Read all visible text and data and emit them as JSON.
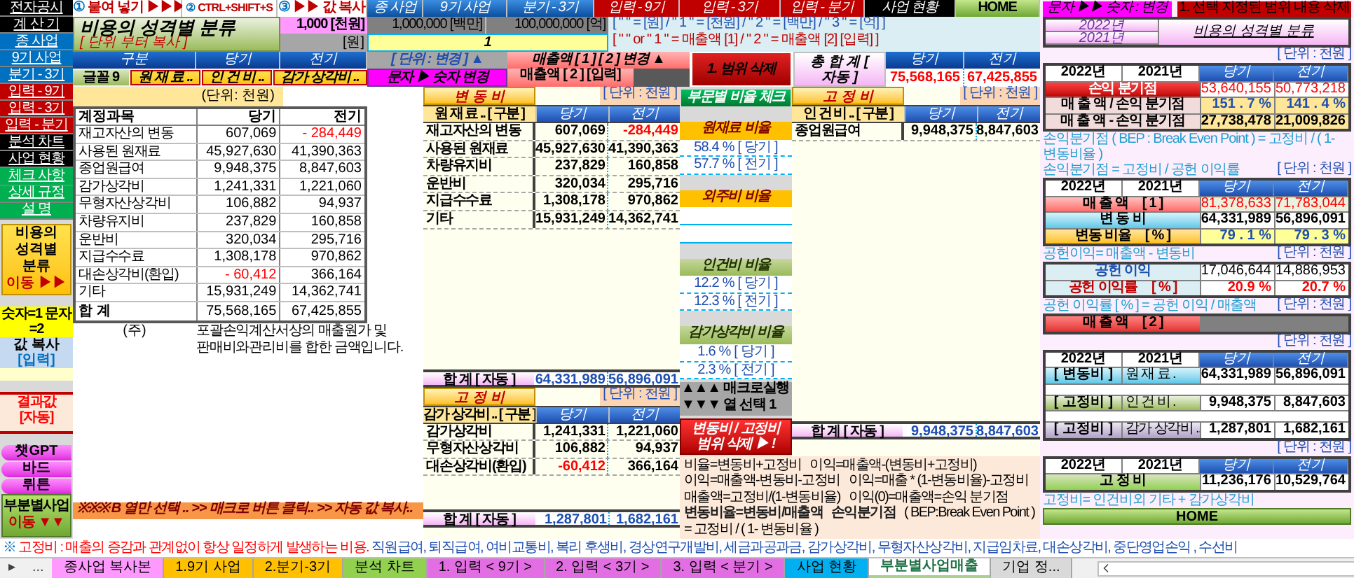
{
  "nav": [
    {
      "label": "전자공시",
      "kind": "dark"
    },
    {
      "label": "계 산 기",
      "kind": "dark"
    },
    {
      "label": "종 사업",
      "kind": "blue"
    },
    {
      "label": "9기 사업",
      "kind": "blue"
    },
    {
      "label": "분기 - 3기",
      "kind": "blue"
    },
    {
      "label": "입력 - 9기",
      "kind": "red"
    },
    {
      "label": "입력 - 3기",
      "kind": "red"
    },
    {
      "label": "입력 - 분기",
      "kind": "red"
    },
    {
      "label": "분석 차트",
      "kind": "dark"
    },
    {
      "label": "사업 현황",
      "kind": "dark"
    },
    {
      "label": "체크 사항",
      "kind": "green"
    },
    {
      "label": "상세 규정",
      "kind": "green"
    },
    {
      "label": "설 명",
      "kind": "green"
    }
  ],
  "nav_jump": {
    "lines": [
      "비용의",
      "성격별",
      "분류"
    ],
    "action": "이동 ▶▶"
  },
  "nav_mode": "숫자=1 문자=2",
  "nav_copy": {
    "label": "값 복사",
    "tag": "[입력]"
  },
  "nav_result": "결과값 [자동]",
  "nav_ai": [
    "챗GPT",
    "바드",
    "뤼튼"
  ],
  "nav_bottom": {
    "label": "부분별사업",
    "action": "이동 ▼▼"
  },
  "toolbar": [
    {
      "step": "①",
      "label": "붙여 넣기 ▶▶▶",
      "kind": "step"
    },
    {
      "step": "②",
      "label": "CTRL+SHIFT+S",
      "kind": "step"
    },
    {
      "step": "③",
      "label": "▶▶ 값 복사",
      "kind": "step"
    },
    {
      "label": "종 사업",
      "kind": "blue"
    },
    {
      "label": "9기 사업",
      "kind": "blue"
    },
    {
      "label": "분기 - 3기",
      "kind": "blue"
    },
    {
      "label": "입력 - 9기",
      "kind": "red"
    },
    {
      "label": "입력 - 3기",
      "kind": "red"
    },
    {
      "label": "입력 - 분기",
      "kind": "red"
    },
    {
      "label": "사업 현황",
      "kind": "dark"
    },
    {
      "label": "HOME",
      "kind": "green"
    }
  ],
  "title": {
    "text": "비용의 성격별 분류",
    "hint": "[ 단위 부터 복사 ]"
  },
  "units": {
    "thousand": "1,000 [천원]",
    "won": "[원]",
    "million": "1,000,000 [백만]",
    "hundred_million": "100,000,000 [억]",
    "selected_unit": "1",
    "legend_units": "[ \" \" = [원]  / \" 1 \" = [천원]  / \" 2 \" = [백만]  / \" 3 \" = [억] ]",
    "legend_sales": "[ \" \" or \" 1 \" = 매출액 [1]  / \" 2 \" = 매출액 [2] [입력] ]"
  },
  "header": {
    "col_1": "구분",
    "current": "당기",
    "prior": "전기",
    "unit_change": "[ 단위 : 변경 ] ▲",
    "sales_change": "매출액 [ 1 ] [ 2 ] 변경 ▲",
    "delete_range": "1. 범위 삭제",
    "text_to_number": "문자 ▶ 숫자 변경",
    "sales2_input": "매출액 [ 2 ] [입력]"
  },
  "grand_total": {
    "label": "총 합 계 [ 자동 ]",
    "current_header": "당기",
    "prior_header": "전기",
    "current": "75,568,165",
    "prior": "67,425,855"
  },
  "filters": [
    {
      "label": "글꼴 9",
      "kind": "font"
    },
    {
      "label": "원 재 료 ..",
      "kind": "category"
    },
    {
      "label": "인 건 비 ..",
      "kind": "category"
    },
    {
      "label": "감가 상각비 ..",
      "kind": "category"
    }
  ],
  "accounts": {
    "unit": "(단위: 천원)",
    "columns": [
      "계정과목",
      "당기",
      "전기"
    ],
    "rows": [
      {
        "name": "재고자산의 변동",
        "current": "607,069",
        "prior": "- 284,449",
        "current_negative": false,
        "prior_negative": true
      },
      {
        "name": "사용된 원재료",
        "current": "45,927,630",
        "prior": "41,390,363",
        "current_negative": false,
        "prior_negative": false
      },
      {
        "name": "종업원급여",
        "current": "9,948,375",
        "prior": "8,847,603",
        "current_negative": false,
        "prior_negative": false
      },
      {
        "name": "감가상각비",
        "current": "1,241,331",
        "prior": "1,221,060",
        "current_negative": false,
        "prior_negative": false
      },
      {
        "name": "무형자산상각비",
        "current": "106,882",
        "prior": "94,937",
        "current_negative": false,
        "prior_negative": false
      },
      {
        "name": "차량유지비",
        "current": "237,829",
        "prior": "160,858",
        "current_negative": false,
        "prior_negative": false
      },
      {
        "name": "운반비",
        "current": "320,034",
        "prior": "295,716",
        "current_negative": false,
        "prior_negative": false
      },
      {
        "name": "지급수수료",
        "current": "1,308,178",
        "prior": "970,862",
        "current_negative": false,
        "prior_negative": false
      },
      {
        "name": "대손상각비(환입)",
        "current": "- 60,412",
        "prior": "366,164",
        "current_negative": true,
        "prior_negative": false
      },
      {
        "name": "기타",
        "current": "15,931,249",
        "prior": "14,362,741",
        "current_negative": false,
        "prior_negative": false
      }
    ],
    "total": {
      "label": "합 계",
      "current": "75,568,165",
      "prior": "67,425,855"
    },
    "note_mark": "(주)",
    "note": "포괄손익계산서상의 매출원가 및 판매비와관리비를 합한 금액입니다."
  },
  "macro_hint": "※※※  B 열만 선택 ..  >>  매크로 버튼 클릭..  >>  자동 값 복사..",
  "variable_costs": {
    "title": "변 동 비",
    "unit": "[ 단위 : 천원 ]",
    "columns": [
      "원 재 료 .. [ 구분 ]",
      "당기",
      "전기"
    ],
    "rows": [
      {
        "name": "재고자산의 변동",
        "current": "607,069",
        "prior": "-284,449",
        "current_negative": false,
        "prior_negative": true
      },
      {
        "name": "사용된 원재료",
        "current": "45,927,630",
        "prior": "41,390,363",
        "current_negative": false,
        "prior_negative": false
      },
      {
        "name": "차량유지비",
        "current": "237,829",
        "prior": "160,858",
        "current_negative": false,
        "prior_negative": false
      },
      {
        "name": "운반비",
        "current": "320,034",
        "prior": "295,716",
        "current_negative": false,
        "prior_negative": false
      },
      {
        "name": "지급수수료",
        "current": "1,308,178",
        "prior": "970,862",
        "current_negative": false,
        "prior_negative": false
      },
      {
        "name": "기타",
        "current": "15,931,249",
        "prior": "14,362,741",
        "current_negative": false,
        "prior_negative": false
      }
    ],
    "total": {
      "label": "합 계 [ 자동 ]",
      "current": "64,331,989",
      "prior": "56,896,091"
    }
  },
  "depreciation": {
    "title": "고 정 비",
    "unit": "[ 단위 : 천원 ]",
    "columns": [
      "감가 상각비 .. [ 구분 ]",
      "당기",
      "전기"
    ],
    "rows": [
      {
        "name": "감가상각비",
        "current": "1,241,331",
        "prior": "1,221,060",
        "current_negative": false,
        "prior_negative": false
      },
      {
        "name": "무형자산상각비",
        "current": "106,882",
        "prior": "94,937",
        "current_negative": false,
        "prior_negative": false
      },
      {
        "name": "대손상각비(환입)",
        "current": "-60,412",
        "prior": "366,164",
        "current_negative": true,
        "prior_negative": false
      }
    ],
    "total": {
      "label": "합 계 [ 자동 ]",
      "current": "1,287,801",
      "prior": "1,682,161"
    }
  },
  "ratios": {
    "check_button": "부문별 비율 체크",
    "groups": [
      {
        "title": "원재료 비율",
        "kind": "gold",
        "current": "58.4 % [ 당기 ]",
        "prior": "57.7 % [ 전기 ]"
      },
      {
        "title": "외주비 비율",
        "kind": "gold"
      },
      {
        "title": "인건비 비율",
        "kind": "olive",
        "current": "12.2 % [ 당기 ]",
        "prior": "12.3 % [ 전기 ]"
      },
      {
        "title": "감가상각비 비율",
        "kind": "olive",
        "current": "1.6 % [ 당기 ]",
        "prior": "2.3 % [ 전기 ]"
      }
    ],
    "macro_run": "▲▲▲ 매크로실행",
    "column_select": "▼▼▼ 열 선택 1",
    "clear_button": "변동비 / 고정비 범위 삭제 ▶ !"
  },
  "labor": {
    "title": "고 정 비",
    "unit": "[ 단위 : 천원 ]",
    "columns": [
      "인 건 비 .. [ 구분 ]",
      "당기",
      "전기"
    ],
    "rows": [
      {
        "name": "종업원급여",
        "current": "9,948,375",
        "prior": "8,847,603",
        "current_negative": false,
        "prior_negative": false
      }
    ],
    "total": {
      "label": "합 계 [ 자동 ]",
      "current": "9,948,375",
      "prior": "8,847,603"
    }
  },
  "formulas": [
    {
      "text": "비율=변동비+고정비",
      "kind": "plain"
    },
    {
      "text": "이익=매출액-(변동비+고정비)",
      "kind": "plain"
    },
    {
      "text": "이익=매출액-변동비-고정비",
      "kind": "plain"
    },
    {
      "text": "이익=매출 * (1-변동비율)-고정비",
      "kind": "plain"
    },
    {
      "text": "매출액=고정비/(1-변동비율)",
      "kind": "plain"
    },
    {
      "text": "이익(0)=매출액=손익 분기점",
      "kind": "plain"
    },
    {
      "text": "변동비율=변동비/매출액",
      "kind": "bold"
    },
    {
      "text": "손익분기점",
      "kind": "bold"
    },
    {
      "text": "( BEP:Break Even Point )",
      "kind": "plain"
    },
    {
      "text": "= 고정비 / ( 1- 변동비율 )",
      "kind": "plain"
    }
  ],
  "bep_panel": {
    "convert_button": "문자 ▶▶ 숫자 : 변경",
    "clear_button": "1. 선택 지정된 범위 내용 삭제",
    "years": [
      "2022년",
      "2021년"
    ],
    "title": "비용의 성격별 분류",
    "sections": [
      {
        "kind": "unit",
        "unit": "[ 단위 : 천원 ]"
      },
      {
        "kind": "table",
        "header": [
          "2022년",
          "2021년",
          "당기",
          "전기"
        ],
        "rows": [
          {
            "label": "손익 분기점",
            "kind": "bep",
            "current": "53,640,155",
            "prior": "50,773,218"
          },
          {
            "label": "매 출 액  /  손익 분기점",
            "kind": "ratio",
            "current": "151 . 7 %",
            "prior": "141 . 4 %"
          },
          {
            "label": "매 출 액  -  손익 분기점",
            "kind": "gap",
            "current": "27,738,478",
            "prior": "21,009,826"
          }
        ]
      },
      {
        "kind": "note",
        "text": "손익분기점 ( BEP : Break Even Point )  = 고정비 / ( 1- 변동비율 )"
      },
      {
        "kind": "note",
        "text": "손익분기점 = 고정비 / 공헌 이익률",
        "unit": "[ 단위 : 천원 ]"
      },
      {
        "kind": "table",
        "header": [
          "2022년",
          "2021년",
          "당기",
          "전기"
        ],
        "rows": [
          {
            "label": "매 출 액",
            "suffix": "[ 1 ]",
            "kind": "sales",
            "current": "81,378,633",
            "prior": "71,783,044"
          },
          {
            "label": "변 동 비",
            "kind": "variable",
            "current": "64,331,989",
            "prior": "56,896,091"
          },
          {
            "label": "변동 비율",
            "suffix": "[ % ]",
            "kind": "variable_ratio",
            "current": "79 . 1 %",
            "prior": "79 . 3 %"
          }
        ]
      },
      {
        "kind": "note",
        "text": "공헌이익= 매출액 - 변동비",
        "unit": "[ 단위 : 천원 ]"
      },
      {
        "kind": "table",
        "rows": [
          {
            "label": "공헌 이익",
            "kind": "contribution",
            "current": "17,046,644",
            "prior": "14,886,953"
          },
          {
            "label": "공헌 이익률",
            "suffix": "[ % ]",
            "kind": "contribution_ratio",
            "current": "20.9 %",
            "prior": "20.7 %"
          }
        ]
      },
      {
        "kind": "note",
        "text": "공헌 이익률 [ % ] = 공헌 이익 / 매출액",
        "unit": "[ 단위 : 천원 ]"
      },
      {
        "kind": "table",
        "rows": [
          {
            "label": "매 출 액",
            "suffix": "[ 2 ]",
            "kind": "sales2"
          }
        ]
      },
      {
        "kind": "unit",
        "unit": "[ 단위 : 천원 ]"
      },
      {
        "kind": "table",
        "header": [
          "2022년",
          "2021년",
          "당기",
          "전기"
        ],
        "rows": [
          {
            "tag": "[ 변동비 ]",
            "label": "원 재 료 .",
            "kind": "variable",
            "current": "64,331,989",
            "prior": "56,896,091"
          },
          {
            "tag": "[ 고정비 ]",
            "label": "인 건 비 .",
            "kind": "labor",
            "current": "9,948,375",
            "prior": "8,847,603"
          },
          {
            "tag": "[ 고정비 ]",
            "label": "감가 상각비 ..",
            "kind": "depreciation",
            "current": "1,287,801",
            "prior": "1,682,161"
          }
        ]
      },
      {
        "kind": "unit",
        "unit": "[ 단위 : 천원 ]"
      },
      {
        "kind": "table",
        "header": [
          "2022년",
          "2021년",
          "당기",
          "전기"
        ],
        "rows": [
          {
            "label": "고 정 비",
            "kind": "fixed",
            "current": "11,236,176",
            "prior": "10,529,764"
          }
        ]
      },
      {
        "kind": "note",
        "text": "고정비= 인건비외 기타 + 감가상각비"
      },
      {
        "kind": "button",
        "text": "HOME"
      }
    ]
  },
  "footnote": {
    "mark": "※",
    "lead": "고정비 : 매출의 증감과 관계없이 항상 일정하게 발생하는 비용.",
    "items": "직원급여, 퇴직급여, 여비교통비, 복리 후생비, 경상연구개발비, 세금과공과금, 감가상각비, 무형자산상각비, 지급임차료, 대손상각비, 중단영업손익 , 수선비"
  },
  "sheet_nav": [
    "▸",
    "..."
  ],
  "sheet_tabs": [
    {
      "label": "종사업 복사본",
      "color": "#ff99ff",
      "selected": false
    },
    {
      "label": "1.9기 사업",
      "color": "#ffc000",
      "selected": false
    },
    {
      "label": "2.분기-3기",
      "color": "#ffc000",
      "selected": false
    },
    {
      "label": "분석 차트",
      "color": "#92d050",
      "selected": false
    },
    {
      "label": "1. 입력 < 9기 >",
      "color": "#e36ee3",
      "selected": false
    },
    {
      "label": "2. 입력 < 3기 >",
      "color": "#e36ee3",
      "selected": false
    },
    {
      "label": "3. 입력 < 분기 >",
      "color": "#e36ee3",
      "selected": false
    },
    {
      "label": "사업 현황",
      "color": "#00b0f0",
      "selected": false
    },
    {
      "label": "부분별사업매출",
      "color": "#a9d08e",
      "selected": true
    },
    {
      "label": "기업 정...",
      "color": "#d9d9d9",
      "selected": false
    }
  ]
}
